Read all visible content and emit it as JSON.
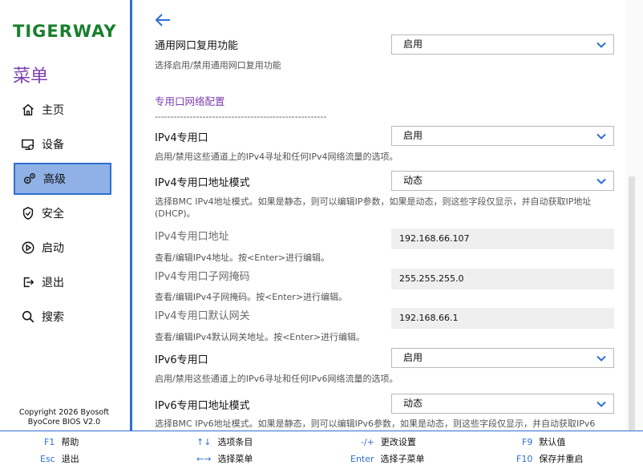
{
  "sidebar": {
    "logo": "TIGERWAY",
    "menu_title": "菜单",
    "items": [
      {
        "label": "主页",
        "icon": "home-icon"
      },
      {
        "label": "设备",
        "icon": "device-icon"
      },
      {
        "label": "高级",
        "icon": "advanced-gears-icon",
        "active": true
      },
      {
        "label": "安全",
        "icon": "shield-icon"
      },
      {
        "label": "启动",
        "icon": "boot-icon"
      },
      {
        "label": "退出",
        "icon": "exit-icon"
      },
      {
        "label": "搜索",
        "icon": "search-icon"
      }
    ],
    "copyright_line1": "Copyright 2026 Byosoft",
    "copyright_line2": "ByoCore BIOS V2.0"
  },
  "main": {
    "rows": [
      {
        "label": "通用网口复用功能",
        "value": "启用",
        "desc": "选择启用/禁用通用网口复用功能"
      },
      {
        "section": "专用口网络配置",
        "dashes": "------------------------------------------------------"
      },
      {
        "label": "IPv4专用口",
        "value": "启用",
        "desc": "启用/禁用这些通道上的IPv4寻址和任何IPv4网络流量的选项。"
      },
      {
        "label": "IPv4专用口地址模式",
        "value": "动态",
        "desc": "选择BMC IPv4地址模式。如果是静态，则可以编辑IP参数，如果是动态，则这些字段仅显示，并自动获取IP地址(DHCP)。"
      },
      {
        "label": "IPv4专用口地址",
        "value": "192.168.66.107",
        "desc": "查看/编辑IPv4地址。按<Enter>进行编辑。"
      },
      {
        "label": "IPv4专用口子网掩码",
        "value": "255.255.255.0",
        "desc": "查看/编辑IPv4子网掩码。按<Enter>进行编辑。"
      },
      {
        "label": "IPv4专用口默认网关",
        "value": "192.168.66.1",
        "desc": "查看/编辑IPv4默认网关地址。按<Enter>进行编辑。"
      },
      {
        "label": "IPv6专用口",
        "value": "启用",
        "desc": "启用/禁用这些通道上的IPv6寻址和任何IPv6网络流量的选项。"
      },
      {
        "label": "IPv6专用口地址模式",
        "value": "动态",
        "desc": "选择BMC IPv6地址模式。如果是静态，则可以编辑IPv6参数，如果是动态，则这些字段仅显示，并自动获取IPv6"
      }
    ]
  },
  "footer": {
    "keys": [
      {
        "key": "F1",
        "label": "帮助"
      },
      {
        "key": "Esc",
        "label": "退出"
      },
      {
        "key": "↑↓",
        "label": "选项条目"
      },
      {
        "key": "←→",
        "label": "选择菜单"
      },
      {
        "key": "-/+",
        "label": "更改设置"
      },
      {
        "key": "Enter",
        "label": "选择子菜单"
      },
      {
        "key": "F9",
        "label": "默认值"
      },
      {
        "key": "F10",
        "label": "保存并重启"
      }
    ]
  },
  "colors": {
    "accent": "#2f6fd1",
    "brand": "#1a7f2e",
    "menu_title": "#7b3fb0",
    "active_bg": "#8fb1e6"
  }
}
